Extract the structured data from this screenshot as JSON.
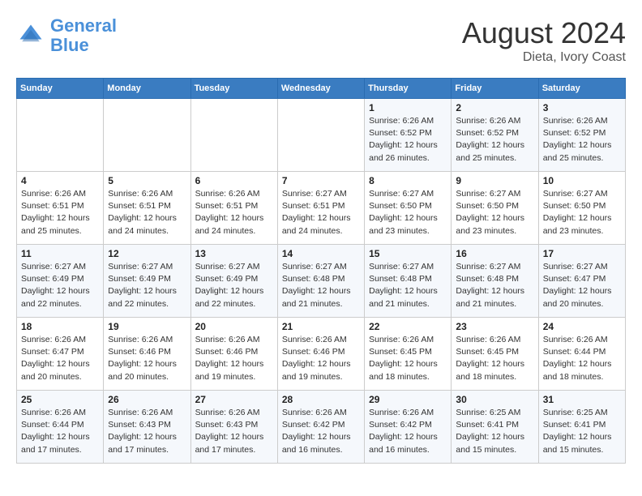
{
  "header": {
    "logo_line1": "General",
    "logo_line2": "Blue",
    "month_year": "August 2024",
    "location": "Dieta, Ivory Coast"
  },
  "days_of_week": [
    "Sunday",
    "Monday",
    "Tuesday",
    "Wednesday",
    "Thursday",
    "Friday",
    "Saturday"
  ],
  "weeks": [
    [
      {
        "day": "",
        "info": ""
      },
      {
        "day": "",
        "info": ""
      },
      {
        "day": "",
        "info": ""
      },
      {
        "day": "",
        "info": ""
      },
      {
        "day": "1",
        "info": "Sunrise: 6:26 AM\nSunset: 6:52 PM\nDaylight: 12 hours\nand 26 minutes."
      },
      {
        "day": "2",
        "info": "Sunrise: 6:26 AM\nSunset: 6:52 PM\nDaylight: 12 hours\nand 25 minutes."
      },
      {
        "day": "3",
        "info": "Sunrise: 6:26 AM\nSunset: 6:52 PM\nDaylight: 12 hours\nand 25 minutes."
      }
    ],
    [
      {
        "day": "4",
        "info": "Sunrise: 6:26 AM\nSunset: 6:51 PM\nDaylight: 12 hours\nand 25 minutes."
      },
      {
        "day": "5",
        "info": "Sunrise: 6:26 AM\nSunset: 6:51 PM\nDaylight: 12 hours\nand 24 minutes."
      },
      {
        "day": "6",
        "info": "Sunrise: 6:26 AM\nSunset: 6:51 PM\nDaylight: 12 hours\nand 24 minutes."
      },
      {
        "day": "7",
        "info": "Sunrise: 6:27 AM\nSunset: 6:51 PM\nDaylight: 12 hours\nand 24 minutes."
      },
      {
        "day": "8",
        "info": "Sunrise: 6:27 AM\nSunset: 6:50 PM\nDaylight: 12 hours\nand 23 minutes."
      },
      {
        "day": "9",
        "info": "Sunrise: 6:27 AM\nSunset: 6:50 PM\nDaylight: 12 hours\nand 23 minutes."
      },
      {
        "day": "10",
        "info": "Sunrise: 6:27 AM\nSunset: 6:50 PM\nDaylight: 12 hours\nand 23 minutes."
      }
    ],
    [
      {
        "day": "11",
        "info": "Sunrise: 6:27 AM\nSunset: 6:49 PM\nDaylight: 12 hours\nand 22 minutes."
      },
      {
        "day": "12",
        "info": "Sunrise: 6:27 AM\nSunset: 6:49 PM\nDaylight: 12 hours\nand 22 minutes."
      },
      {
        "day": "13",
        "info": "Sunrise: 6:27 AM\nSunset: 6:49 PM\nDaylight: 12 hours\nand 22 minutes."
      },
      {
        "day": "14",
        "info": "Sunrise: 6:27 AM\nSunset: 6:48 PM\nDaylight: 12 hours\nand 21 minutes."
      },
      {
        "day": "15",
        "info": "Sunrise: 6:27 AM\nSunset: 6:48 PM\nDaylight: 12 hours\nand 21 minutes."
      },
      {
        "day": "16",
        "info": "Sunrise: 6:27 AM\nSunset: 6:48 PM\nDaylight: 12 hours\nand 21 minutes."
      },
      {
        "day": "17",
        "info": "Sunrise: 6:27 AM\nSunset: 6:47 PM\nDaylight: 12 hours\nand 20 minutes."
      }
    ],
    [
      {
        "day": "18",
        "info": "Sunrise: 6:26 AM\nSunset: 6:47 PM\nDaylight: 12 hours\nand 20 minutes."
      },
      {
        "day": "19",
        "info": "Sunrise: 6:26 AM\nSunset: 6:46 PM\nDaylight: 12 hours\nand 20 minutes."
      },
      {
        "day": "20",
        "info": "Sunrise: 6:26 AM\nSunset: 6:46 PM\nDaylight: 12 hours\nand 19 minutes."
      },
      {
        "day": "21",
        "info": "Sunrise: 6:26 AM\nSunset: 6:46 PM\nDaylight: 12 hours\nand 19 minutes."
      },
      {
        "day": "22",
        "info": "Sunrise: 6:26 AM\nSunset: 6:45 PM\nDaylight: 12 hours\nand 18 minutes."
      },
      {
        "day": "23",
        "info": "Sunrise: 6:26 AM\nSunset: 6:45 PM\nDaylight: 12 hours\nand 18 minutes."
      },
      {
        "day": "24",
        "info": "Sunrise: 6:26 AM\nSunset: 6:44 PM\nDaylight: 12 hours\nand 18 minutes."
      }
    ],
    [
      {
        "day": "25",
        "info": "Sunrise: 6:26 AM\nSunset: 6:44 PM\nDaylight: 12 hours\nand 17 minutes."
      },
      {
        "day": "26",
        "info": "Sunrise: 6:26 AM\nSunset: 6:43 PM\nDaylight: 12 hours\nand 17 minutes."
      },
      {
        "day": "27",
        "info": "Sunrise: 6:26 AM\nSunset: 6:43 PM\nDaylight: 12 hours\nand 17 minutes."
      },
      {
        "day": "28",
        "info": "Sunrise: 6:26 AM\nSunset: 6:42 PM\nDaylight: 12 hours\nand 16 minutes."
      },
      {
        "day": "29",
        "info": "Sunrise: 6:26 AM\nSunset: 6:42 PM\nDaylight: 12 hours\nand 16 minutes."
      },
      {
        "day": "30",
        "info": "Sunrise: 6:25 AM\nSunset: 6:41 PM\nDaylight: 12 hours\nand 15 minutes."
      },
      {
        "day": "31",
        "info": "Sunrise: 6:25 AM\nSunset: 6:41 PM\nDaylight: 12 hours\nand 15 minutes."
      }
    ]
  ]
}
